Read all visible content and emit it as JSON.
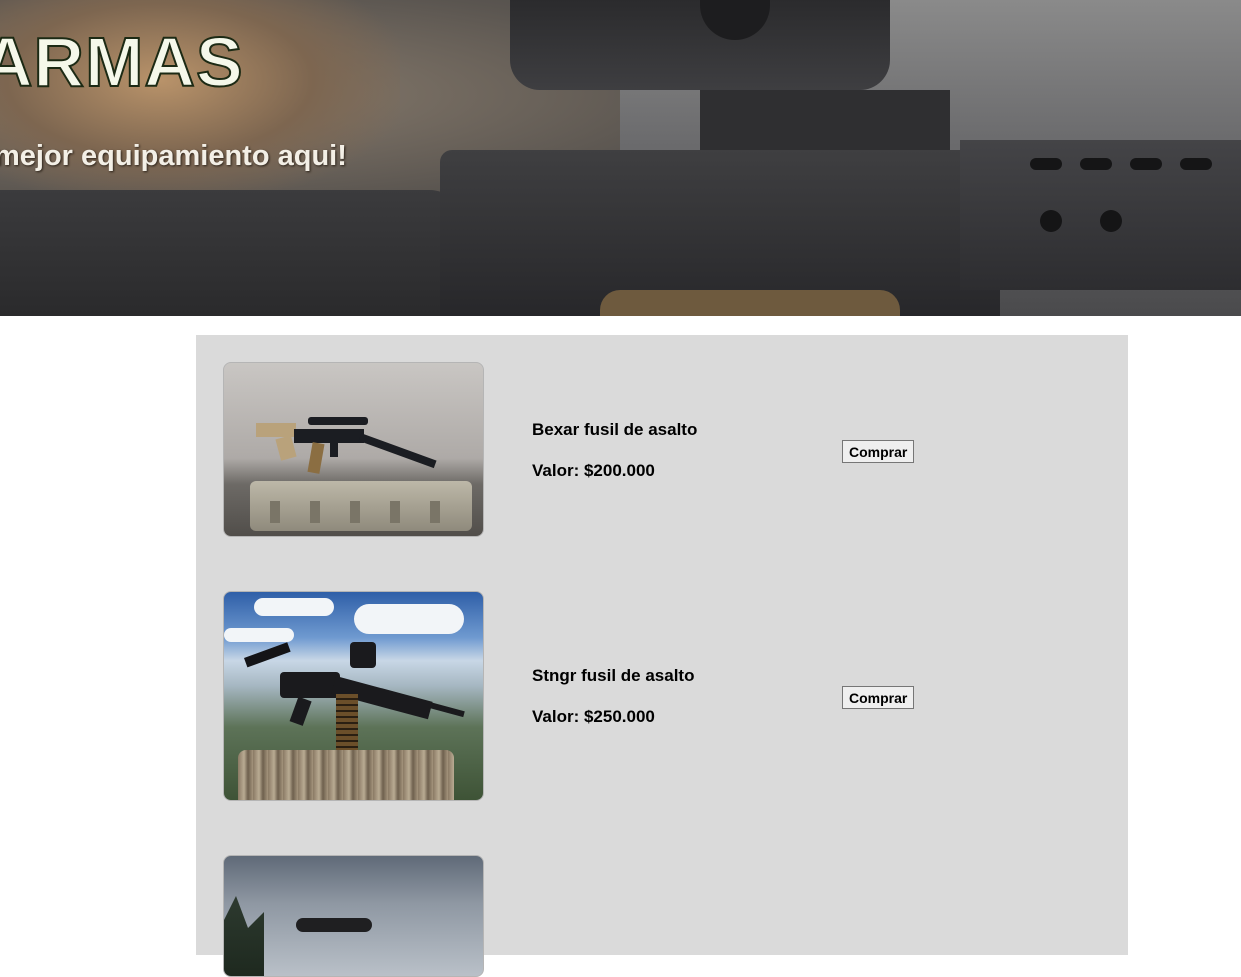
{
  "hero": {
    "title": "ARMAS",
    "subtitle": "mejor equipamiento aqui!"
  },
  "products": [
    {
      "name": "Bexar fusil de asalto",
      "price": "Valor: $200.000",
      "button_label": "Comprar",
      "image_alt": "Bexar rifle on case"
    },
    {
      "name": "Stngr fusil de asalto",
      "price": "Valor: $250.000",
      "button_label": "Comprar",
      "image_alt": "Stngr rifle on stump"
    },
    {
      "image_alt": "Rifle with scope"
    }
  ],
  "colors": {
    "catalog_background": "#dadada",
    "hero_title_text": "#f5f8ea"
  }
}
